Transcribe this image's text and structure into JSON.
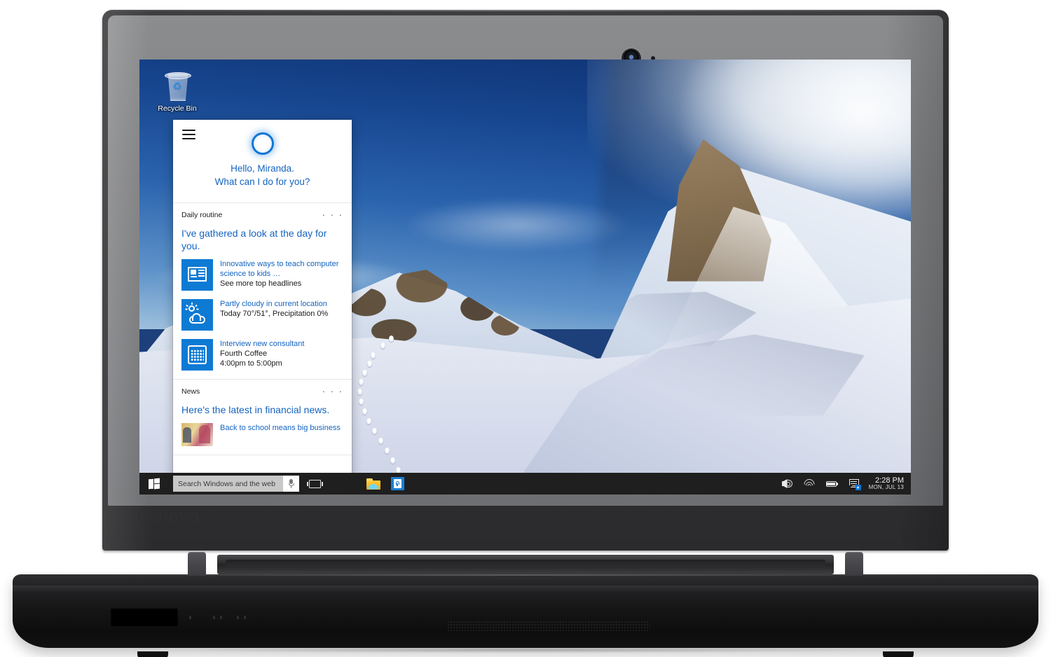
{
  "device": {
    "brand_logo": "Lenovo",
    "webcam": "webcam-lens",
    "mic": "microphone-pinhole"
  },
  "desktop": {
    "recycle_bin_label": "Recycle Bin",
    "wallpaper": "snow-mountain-landscape"
  },
  "cortana": {
    "menu_icon": "hamburger-menu-icon",
    "orb_icon": "cortana-ring-icon",
    "greeting_line1": "Hello, Miranda.",
    "greeting_line2": "What can I do for you?",
    "cards": [
      {
        "title": "Daily routine",
        "overflow": "· · ·",
        "lede": "I've gathered a look at the day for you.",
        "rows": [
          {
            "icon": "news-tile-icon",
            "link": "Innovative ways to teach computer science to kids …",
            "sub": "See more top headlines"
          },
          {
            "icon": "weather-tile-icon",
            "link": "Partly cloudy in current location",
            "sub": "Today 70°/51°, Precipitation 0%"
          },
          {
            "icon": "calendar-tile-icon",
            "link": "Interview new consultant",
            "sub": "Fourth Coffee",
            "sub2": "4:00pm to 5:00pm"
          }
        ]
      },
      {
        "title": "News",
        "overflow": "· · ·",
        "lede": "Here's the latest in financial news.",
        "rows": [
          {
            "icon": "news-photo-thumbnail",
            "link": "Back to school means big business",
            "sub": ""
          }
        ]
      }
    ]
  },
  "taskbar": {
    "start_icon": "windows-start-icon",
    "search": {
      "placeholder": "Search Windows and the web",
      "value": "",
      "mic_icon": "microphone-icon"
    },
    "task_view_icon": "task-view-icon",
    "apps": [
      {
        "name": "file-explorer",
        "icon": "folder-icon"
      },
      {
        "name": "microsoft-store",
        "icon": "store-bag-icon"
      }
    ],
    "tray": [
      {
        "name": "volume",
        "icon": "speaker-icon"
      },
      {
        "name": "network",
        "icon": "wifi-icon"
      },
      {
        "name": "battery",
        "icon": "battery-icon"
      },
      {
        "name": "action-center",
        "icon": "action-center-icon",
        "badge": true
      }
    ],
    "clock": {
      "time": "2:28 PM",
      "date": "MON, JUL 13"
    }
  },
  "colors": {
    "accent_blue": "#1464c0",
    "tile_blue": "#0d7ad4",
    "taskbar": "#1f1f1f",
    "search_field": "#c8c8c8",
    "sky": "#17468f"
  }
}
